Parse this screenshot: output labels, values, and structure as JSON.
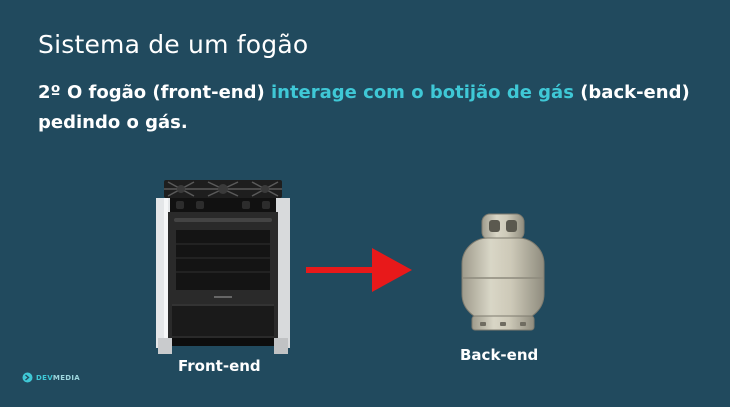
{
  "slide": {
    "title": "Sistema de um fogão",
    "subtitle_prefix": "2º O fogão (front-end) ",
    "subtitle_highlight": "interage com o botijão de gás",
    "subtitle_suffix": " (back-end) pedindo o gás."
  },
  "diagram": {
    "front_label": "Front-end",
    "back_label": "Back-end",
    "stove_icon": "stove-image",
    "arrow_icon": "arrow-right-icon",
    "tank_icon": "gas-cylinder-image",
    "arrow_color": "#e8191a"
  },
  "brand": {
    "logo_icon": "devmedia-logo-icon",
    "name_part1": "DEV",
    "name_part2": "MEDIA"
  },
  "colors": {
    "background": "#214a5e",
    "highlight": "#3fc8d6"
  }
}
